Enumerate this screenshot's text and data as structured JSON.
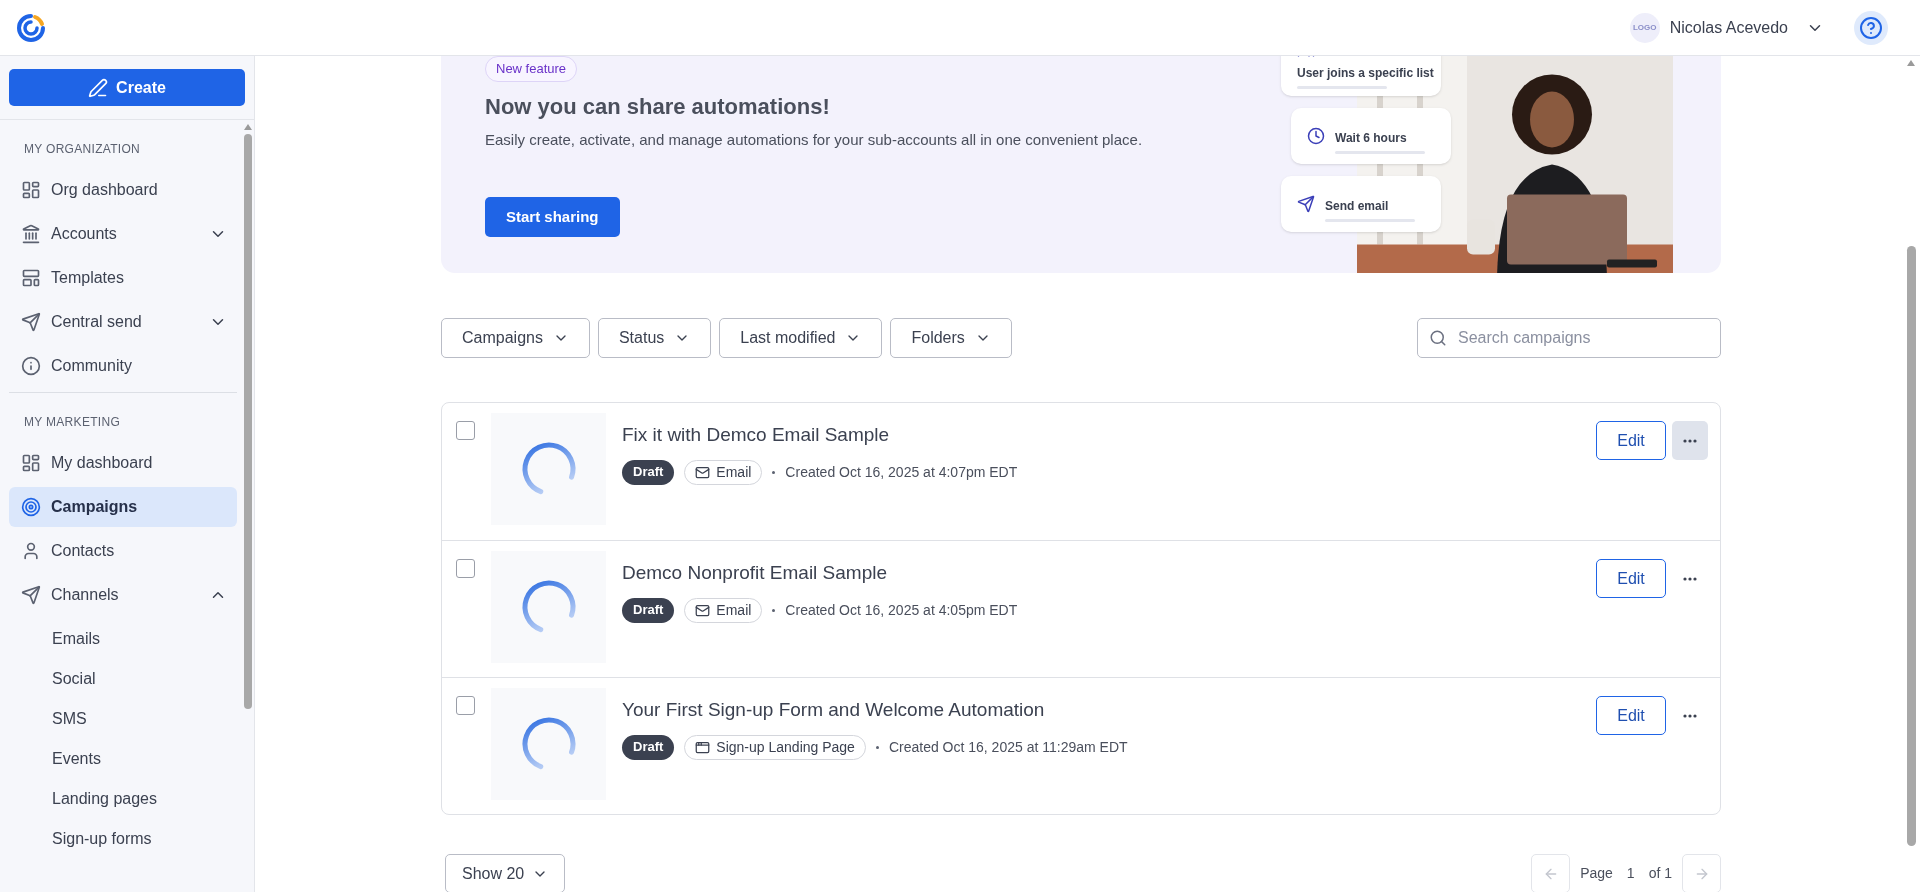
{
  "header": {
    "avatar_text": "LOGO",
    "user_name": "Nicolas Acevedo"
  },
  "sidebar": {
    "create_label": "Create",
    "sections": [
      {
        "title": "MY ORGANIZATION",
        "items": [
          {
            "label": "Org dashboard",
            "selected": false
          },
          {
            "label": "Accounts",
            "selected": false,
            "expanded": false
          },
          {
            "label": "Templates",
            "selected": false
          },
          {
            "label": "Central send",
            "selected": false,
            "expanded": false
          },
          {
            "label": "Community",
            "selected": false
          }
        ]
      },
      {
        "title": "MY MARKETING",
        "items": [
          {
            "label": "My dashboard",
            "selected": false
          },
          {
            "label": "Campaigns",
            "selected": true
          },
          {
            "label": "Contacts",
            "selected": false
          },
          {
            "label": "Channels",
            "selected": false,
            "expanded": true,
            "children": [
              {
                "label": "Emails"
              },
              {
                "label": "Social"
              },
              {
                "label": "SMS"
              },
              {
                "label": "Events"
              },
              {
                "label": "Landing pages"
              },
              {
                "label": "Sign-up forms"
              }
            ]
          }
        ]
      }
    ]
  },
  "banner": {
    "badge": "New feature",
    "title": "Now you can share automations!",
    "description": "Easily create, activate, and manage automations for your sub-accounts all in one convenient place.",
    "button": "Start sharing",
    "steps": [
      {
        "kind": "trigger",
        "label": "User joins a specific list"
      },
      {
        "kind": "wait",
        "label": "Wait 6 hours"
      },
      {
        "kind": "send",
        "label": "Send email"
      }
    ]
  },
  "filters": [
    "Campaigns",
    "Status",
    "Last modified",
    "Folders"
  ],
  "search": {
    "placeholder": "Search campaigns"
  },
  "campaigns": [
    {
      "title": "Fix it with Demco Email Sample",
      "status": "Draft",
      "kind": "email",
      "type_label": "Email",
      "created": "Created Oct 16, 2025 at 4:07pm EDT",
      "checked": false,
      "action": "Edit",
      "menu_hovered": true
    },
    {
      "title": "Demco Nonprofit Email Sample",
      "status": "Draft",
      "kind": "email",
      "type_label": "Email",
      "created": "Created Oct 16, 2025 at 4:05pm EDT",
      "checked": false,
      "action": "Edit",
      "menu_hovered": false
    },
    {
      "title": "Your First Sign-up Form and Welcome Automation",
      "status": "Draft",
      "kind": "page",
      "type_label": "Sign-up Landing Page",
      "created": "Created Oct 16, 2025 at 11:29am EDT",
      "checked": false,
      "action": "Edit",
      "menu_hovered": false
    }
  ],
  "footer": {
    "page_size": "Show 20",
    "page_label": "Page",
    "page": "1",
    "of_label": "of 1",
    "prev_disabled": true,
    "next_disabled": true
  }
}
